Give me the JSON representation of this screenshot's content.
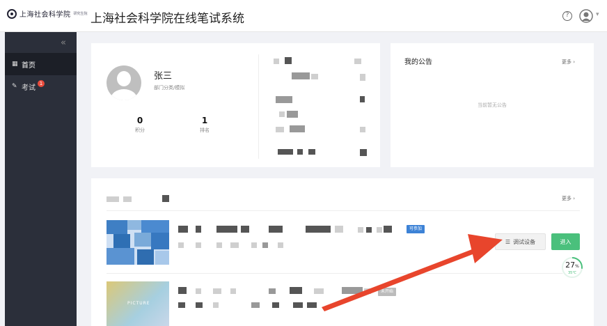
{
  "header": {
    "logo_text": "上海社会科学院",
    "logo_sub": "研究生院",
    "title": "上海社会科学院在线笔试系统",
    "help_icon": "help-circle-icon",
    "user_icon": "user-avatar-icon"
  },
  "sidebar": {
    "collapse_icon": "«",
    "items": [
      {
        "label": "首页",
        "icon": "grid-icon",
        "active": true
      },
      {
        "label": "考试",
        "icon": "edit-icon",
        "badge": "1",
        "active": false
      }
    ]
  },
  "profile": {
    "name": "张三",
    "dept": "部门分类/模拟",
    "stats": [
      {
        "value": "0",
        "label": "积分"
      },
      {
        "value": "1",
        "label": "排名"
      }
    ]
  },
  "notice": {
    "title": "我的公告",
    "more": "更多",
    "empty": "当前暂无公告"
  },
  "exams": {
    "more": "更多",
    "items": [
      {
        "tag": "可参加",
        "debug_label": "调试设备",
        "enter_label": "进入"
      },
      {
        "tag": "未开始",
        "thumb_label": "PICTURE"
      }
    ]
  },
  "gauge": {
    "value": "27",
    "unit": "%",
    "temp": "35℃",
    "fraction": 0.27,
    "color": "#4ac07c"
  },
  "colors": {
    "sidebar_bg": "#2b2f3a",
    "accent_green": "#4ac07c",
    "tag_blue": "#3c82d6",
    "arrow_red": "#e8452c"
  }
}
